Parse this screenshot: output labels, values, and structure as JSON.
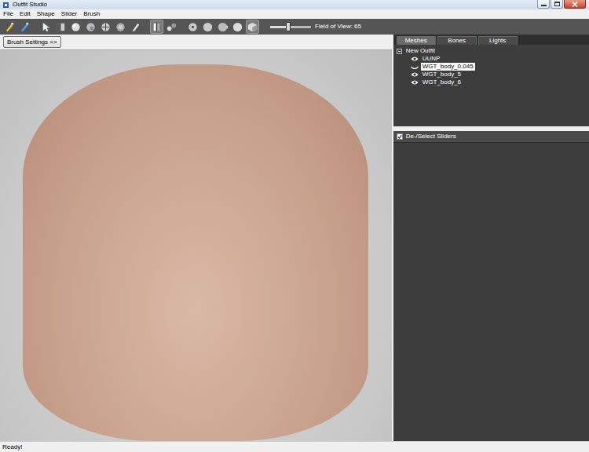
{
  "window": {
    "title": "Outfit Studio"
  },
  "menu": [
    "File",
    "Edit",
    "Shape",
    "Slider",
    "Brush"
  ],
  "toolbar": {
    "tools": [
      {
        "selected": false
      },
      {
        "selected": false
      },
      {
        "selected": false
      },
      {
        "selected": false
      },
      {
        "selected": false
      },
      {
        "selected": false
      },
      {
        "selected": false
      },
      {
        "selected": false
      },
      {
        "selected": false
      },
      {
        "selected": true
      },
      {
        "selected": false
      },
      {
        "selected": false
      },
      {
        "selected": false
      },
      {
        "selected": false
      },
      {
        "selected": false
      },
      {
        "selected": true
      }
    ],
    "fov": {
      "label": "Field of View: 65",
      "level": 0.45
    }
  },
  "brush_settings": "Brush Settings >>",
  "tabs": [
    {
      "label": "Meshes",
      "selected": true
    },
    {
      "label": "Bones",
      "selected": false
    },
    {
      "label": "Lights",
      "selected": false
    }
  ],
  "tree": {
    "root": "New Outfit",
    "expanded": true,
    "items": [
      {
        "label": "UUNP",
        "visible": true,
        "selected": false
      },
      {
        "label": "WGT_body_0.045",
        "visible": false,
        "selected": true
      },
      {
        "label": "WGT_body_5",
        "visible": true,
        "selected": false
      },
      {
        "label": "WGT_body_6",
        "visible": true,
        "selected": false
      }
    ]
  },
  "sliders_panel": {
    "label": "De-/Select Sliders",
    "checked": true
  },
  "status_bar": "Ready!"
}
